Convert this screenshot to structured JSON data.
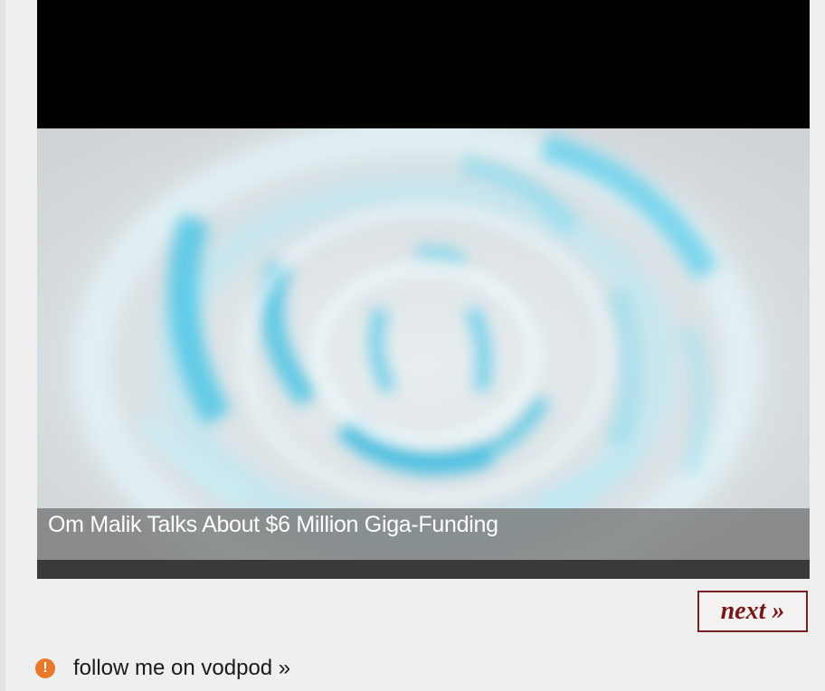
{
  "video": {
    "caption": "Om Malik Talks About $6 Million Giga-Funding"
  },
  "nav": {
    "next_label": "next »"
  },
  "footer": {
    "follow_label": "follow me on vodpod »",
    "icon": "alert-icon",
    "icon_glyph": "!"
  },
  "colors": {
    "accent": "#7a1717",
    "icon_orange": "#e8792c",
    "water_blue": "#3cc3e6"
  }
}
